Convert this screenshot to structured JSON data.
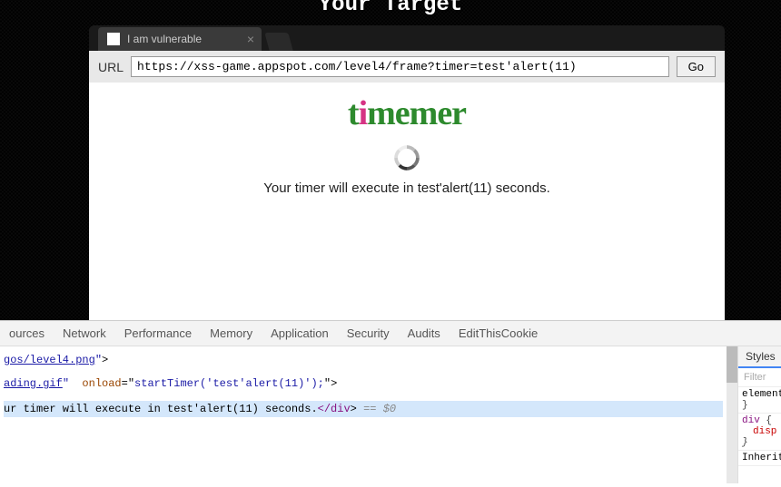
{
  "header": {
    "title": "Your Target"
  },
  "tab": {
    "title": "I am vulnerable",
    "close": "×"
  },
  "urlbar": {
    "label": "URL",
    "value": "https://xss-game.appspot.com/level4/frame?timer=test'alert(11)",
    "go": "Go"
  },
  "page": {
    "logo_t": "t",
    "logo_i": "i",
    "logo_rest": "memer",
    "message": "Your timer will execute in test'alert(11) seconds."
  },
  "devtools": {
    "tabs": [
      "ources",
      "Network",
      "Performance",
      "Memory",
      "Application",
      "Security",
      "Audits",
      "EditThisCookie"
    ],
    "styles_tab": "Styles",
    "filter_placeholder": "Filter",
    "source": {
      "line1_link": "gos/level4.png",
      "line1_quote": "\"",
      "line1_close": ">",
      "line2_link": "ading.gif",
      "line2_quote": "\"",
      "line2_attr": "onload",
      "line2_eq": "=\"",
      "line2_val": "startTimer('test'alert(11)');",
      "line2_endquote": "\"",
      "line2_close": ">",
      "line3_text": "ur timer will execute in test'alert(11) seconds.",
      "line3_closetag": "</div",
      "line3_gt": ">",
      "line3_eq": " == ",
      "line3_dollar": "$0"
    },
    "styles": {
      "element_style": "element",
      "div_sel": "div",
      "disp_prop": "disp",
      "inherited": "Inherite"
    }
  }
}
